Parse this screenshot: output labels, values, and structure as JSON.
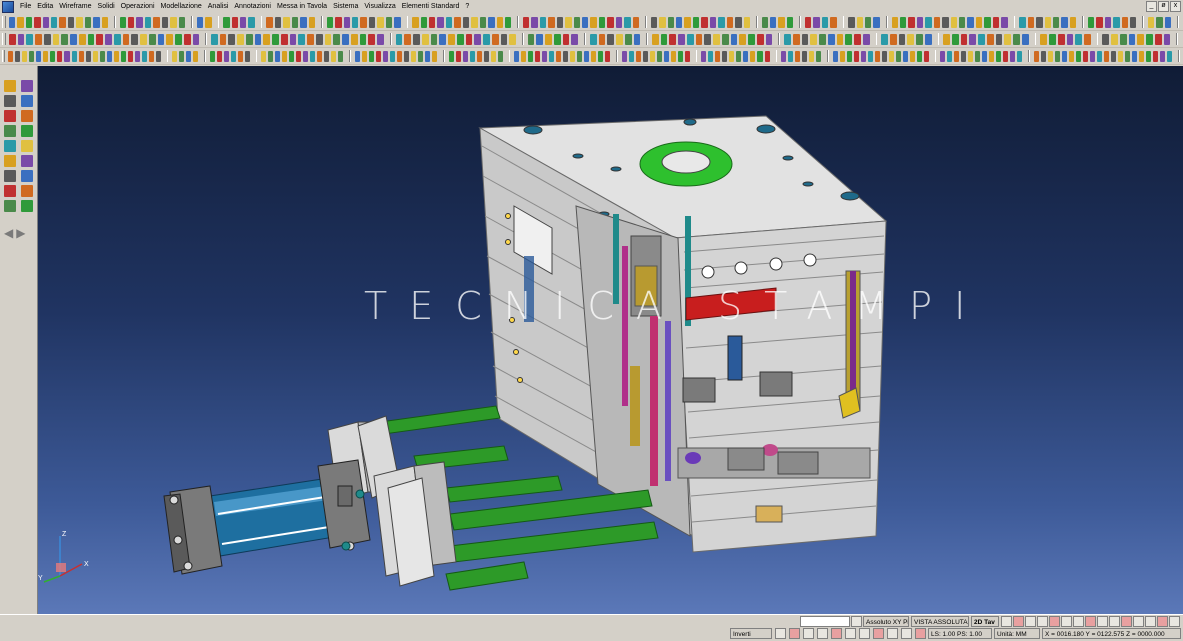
{
  "menu": {
    "items": [
      "File",
      "Edita",
      "Wireframe",
      "Solidi",
      "Operazioni",
      "Modellazione",
      "Analisi",
      "Annotazioni",
      "Messa in Tavola",
      "Sistema",
      "Visualizza",
      "Elementi Standard",
      "?"
    ],
    "window_controls": [
      "_",
      "ø",
      "x"
    ]
  },
  "toolbars": {
    "row_count": 4,
    "palette": [
      "#3a6fc0",
      "#d8a020",
      "#2f9a3a",
      "#c03030",
      "#7a4aa8",
      "#2a9aa8",
      "#d06a20",
      "#5a5a5a",
      "#e0c040",
      "#4a8a4a"
    ]
  },
  "side_palette": {
    "button_count": 18,
    "arrow_left": "◀",
    "arrow_right": "▶"
  },
  "viewport": {
    "watermark": "TECNICA STAMPI",
    "axes": {
      "x": "X",
      "y": "Y",
      "z": "Z"
    },
    "colors": {
      "mold_plate": "#d7d7d7",
      "rod": "#2d9a28",
      "cylinder": "#1e6fa0",
      "ring": "#2ec02e",
      "insert": "#c81e1e"
    }
  },
  "statusbar": {
    "search_placeholder": "",
    "coord_mode": "Assoluto XY Pi",
    "view_mode": "VISTA ASSOLUTA",
    "tav_mode": "2D Tav",
    "invert_label": "Inverti",
    "ls_ps": "LS: 1.00 PS: 1.00",
    "units": "Unità: MM",
    "coords": "X = 0016.180 Y = 0122.575 Z = 0000.000"
  }
}
